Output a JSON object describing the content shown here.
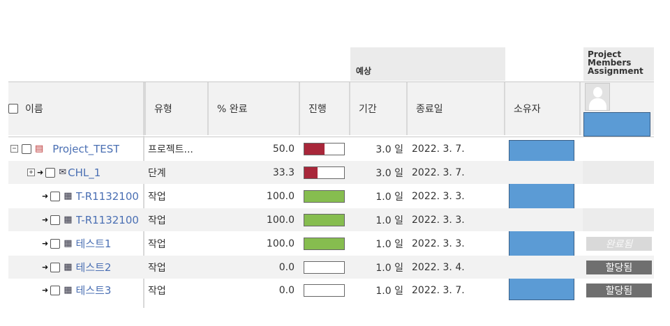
{
  "header": {
    "estimate_group": "예상",
    "members_group": "Project Members Assignment",
    "columns": {
      "name": "이름",
      "type": "유형",
      "percent_complete": "% 완료",
      "progress": "진행",
      "duration": "기간",
      "end_date": "종료일",
      "owner": "소유자"
    }
  },
  "colors": {
    "accent_blue": "#5b9bd5",
    "progress_red": "#a8273a",
    "progress_green": "#86bd4f",
    "assigned_badge": "#6f6f6f",
    "done_badge": "#d9d9d9"
  },
  "rows": [
    {
      "name": "Project_TEST",
      "type": "프로젝트...",
      "percent": "50.0",
      "progress": 0.5,
      "duration": "3.0 일",
      "end": "2022. 3. 7.",
      "status": "",
      "icon": "project-icon"
    },
    {
      "name": "CHL_1",
      "type": "단계",
      "percent": "33.3",
      "progress": 0.333,
      "duration": "3.0 일",
      "end": "2022. 3. 7.",
      "status": "",
      "icon": "phase-icon"
    },
    {
      "name": "T-R1132100",
      "type": "작업",
      "percent": "100.0",
      "progress": 1.0,
      "duration": "1.0 일",
      "end": "2022. 3. 3.",
      "status": "",
      "icon": "task-icon"
    },
    {
      "name": "T-R1132100",
      "type": "작업",
      "percent": "100.0",
      "progress": 1.0,
      "duration": "1.0 일",
      "end": "2022. 3. 3.",
      "status": "",
      "icon": "task-icon"
    },
    {
      "name": "테스트1",
      "type": "작업",
      "percent": "100.0",
      "progress": 1.0,
      "duration": "1.0 일",
      "end": "2022. 3. 3.",
      "status": "완료됨",
      "icon": "task-icon"
    },
    {
      "name": "테스트2",
      "type": "작업",
      "percent": "0.0",
      "progress": 0.0,
      "duration": "1.0 일",
      "end": "2022. 3. 4.",
      "status": "할당됨",
      "icon": "task-icon"
    },
    {
      "name": "테스트3",
      "type": "작업",
      "percent": "0.0",
      "progress": 0.0,
      "duration": "1.0 일",
      "end": "2022. 3. 7.",
      "status": "할당됨",
      "icon": "task-icon"
    }
  ]
}
